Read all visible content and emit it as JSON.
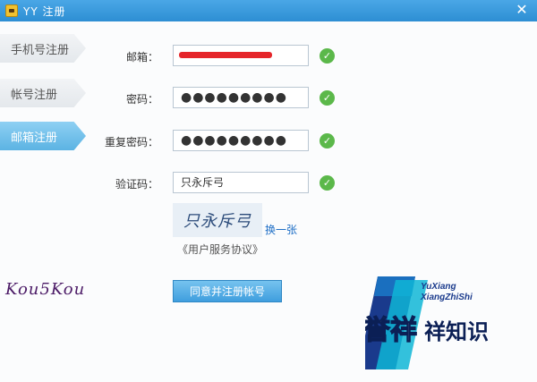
{
  "window": {
    "title": "YY 注册",
    "close_glyph": "✕"
  },
  "sidebar": {
    "tabs": [
      {
        "label": "手机号注册",
        "active": false
      },
      {
        "label": "帐号注册",
        "active": false
      },
      {
        "label": "邮箱注册",
        "active": true
      }
    ]
  },
  "form": {
    "email": {
      "label": "邮箱：",
      "value": "",
      "valid": true
    },
    "password": {
      "label": "密码：",
      "value": "●●●●●●●●●",
      "valid": true
    },
    "password_confirm": {
      "label": "重复密码：",
      "value": "●●●●●●●●●",
      "valid": true
    },
    "captcha_input": {
      "label": "验证码：",
      "value": "只永斥弓",
      "valid": true
    },
    "check_glyph": "✓"
  },
  "captcha": {
    "image_text": "只永斥弓",
    "refresh_label": "换一张"
  },
  "protocol_link": "《用户服务协议》",
  "submit_label": "同意并注册帐号",
  "overlay": {
    "signature": "Kou5Kou",
    "watermark_brand": "誉祥",
    "watermark_en_1": "YuXiang",
    "watermark_en_2": "XiangZhiShi",
    "watermark_cn": "祥知识"
  },
  "colors": {
    "titlebar": "#2d8ed3",
    "accent": "#5cb3e3",
    "valid": "#5bb84a",
    "link": "#1f6fc6",
    "redaction": "#e5252a"
  }
}
